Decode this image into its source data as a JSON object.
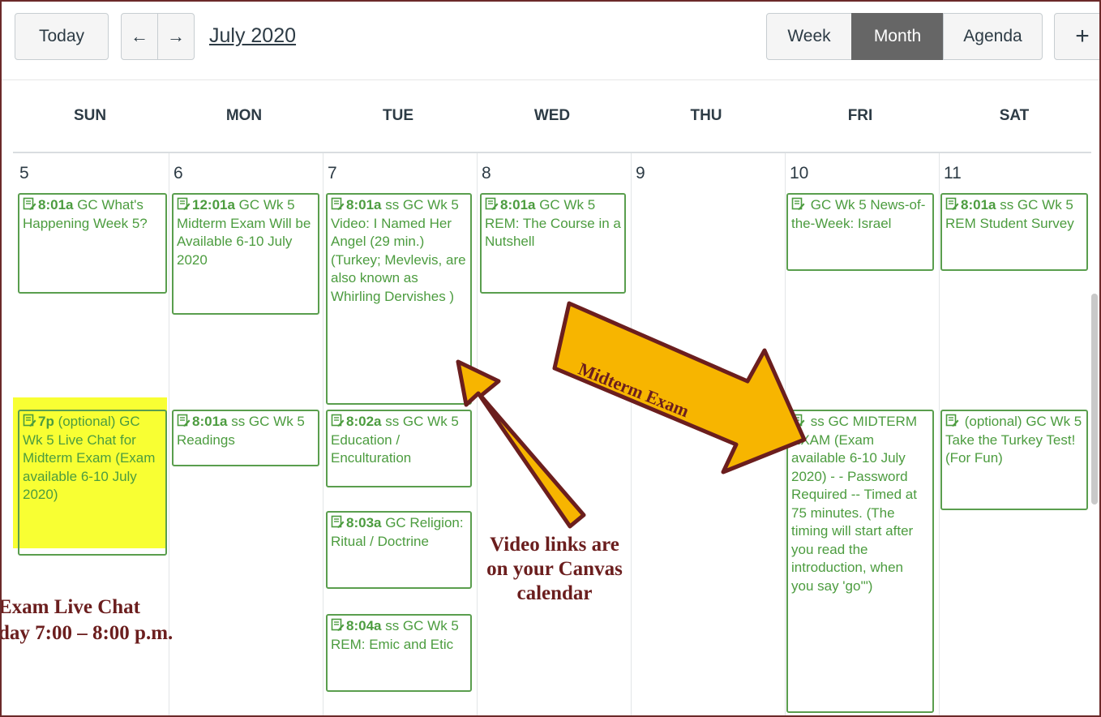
{
  "toolbar": {
    "today_label": "Today",
    "prev_label": "←",
    "next_label": "→",
    "month_title": "July 2020",
    "view_week": "Week",
    "view_month": "Month",
    "view_agenda": "Agenda",
    "add_label": "+"
  },
  "days": [
    "SUN",
    "MON",
    "TUE",
    "WED",
    "THU",
    "FRI",
    "SAT"
  ],
  "dates": [
    "5",
    "6",
    "7",
    "8",
    "9",
    "10",
    "11"
  ],
  "events": {
    "sun1": {
      "time": "8:01a",
      "text": " GC What's Happening Week 5?"
    },
    "sun2": {
      "time": "7p",
      "text": " (optional) GC Wk 5 Live Chat for Midterm Exam (Exam available 6-10 July 2020)"
    },
    "mon1": {
      "time": "12:01a",
      "text": " GC Wk 5 Midterm Exam Will be Available 6-10 July 2020"
    },
    "mon2": {
      "time": "8:01a",
      "text": " ss GC Wk 5 Readings"
    },
    "tue1": {
      "time": "8:01a",
      "text": " ss GC Wk 5 Video: I Named Her Angel (29 min.) (Turkey; Mevlevis, are also known as Whirling Dervishes )"
    },
    "tue2": {
      "time": "8:02a",
      "text": " ss GC Wk 5 Education / Enculturation"
    },
    "tue3": {
      "time": "8:03a",
      "text": " GC Religion: Ritual / Doctrine"
    },
    "tue4": {
      "time": "8:04a",
      "text": " ss GC Wk 5 REM: Emic and Etic"
    },
    "wed1": {
      "time": "8:01a",
      "text": " GC Wk 5 REM: The Course in a Nutshell"
    },
    "fri1": {
      "time": "",
      "text": " GC Wk 5 News-of-the-Week: Israel"
    },
    "fri2": {
      "time": "",
      "text": " ss GC MIDTERM EXAM (Exam available 6-10 July 2020) - - Password Required -- Timed at 75 minutes. (The timing will start after you read the introduction, when you say 'go'\")"
    },
    "sat1": {
      "time": "8:01a",
      "text": " ss GC Wk 5 REM Student Survey"
    },
    "sat2": {
      "time": "",
      "text": " (optional) GC Wk 5 Take the Turkey Test! (For Fun)"
    }
  },
  "annotations": {
    "midterm_arrow": "Midterm Exam",
    "video_links": "Video links are on your Canvas calendar",
    "live_chat_1": "Exam Live Chat",
    "live_chat_2": "day 7:00 – 8:00 p.m."
  },
  "colors": {
    "event_green": "#4c9c3f",
    "arrow_fill": "#f7b500",
    "annotation_text": "#6b1e1e",
    "highlight": "#f8ff33"
  },
  "icons": {
    "event": "assignment-edit-icon",
    "nav_prev": "arrow-left-icon",
    "nav_next": "arrow-right-icon",
    "add": "plus-icon"
  }
}
